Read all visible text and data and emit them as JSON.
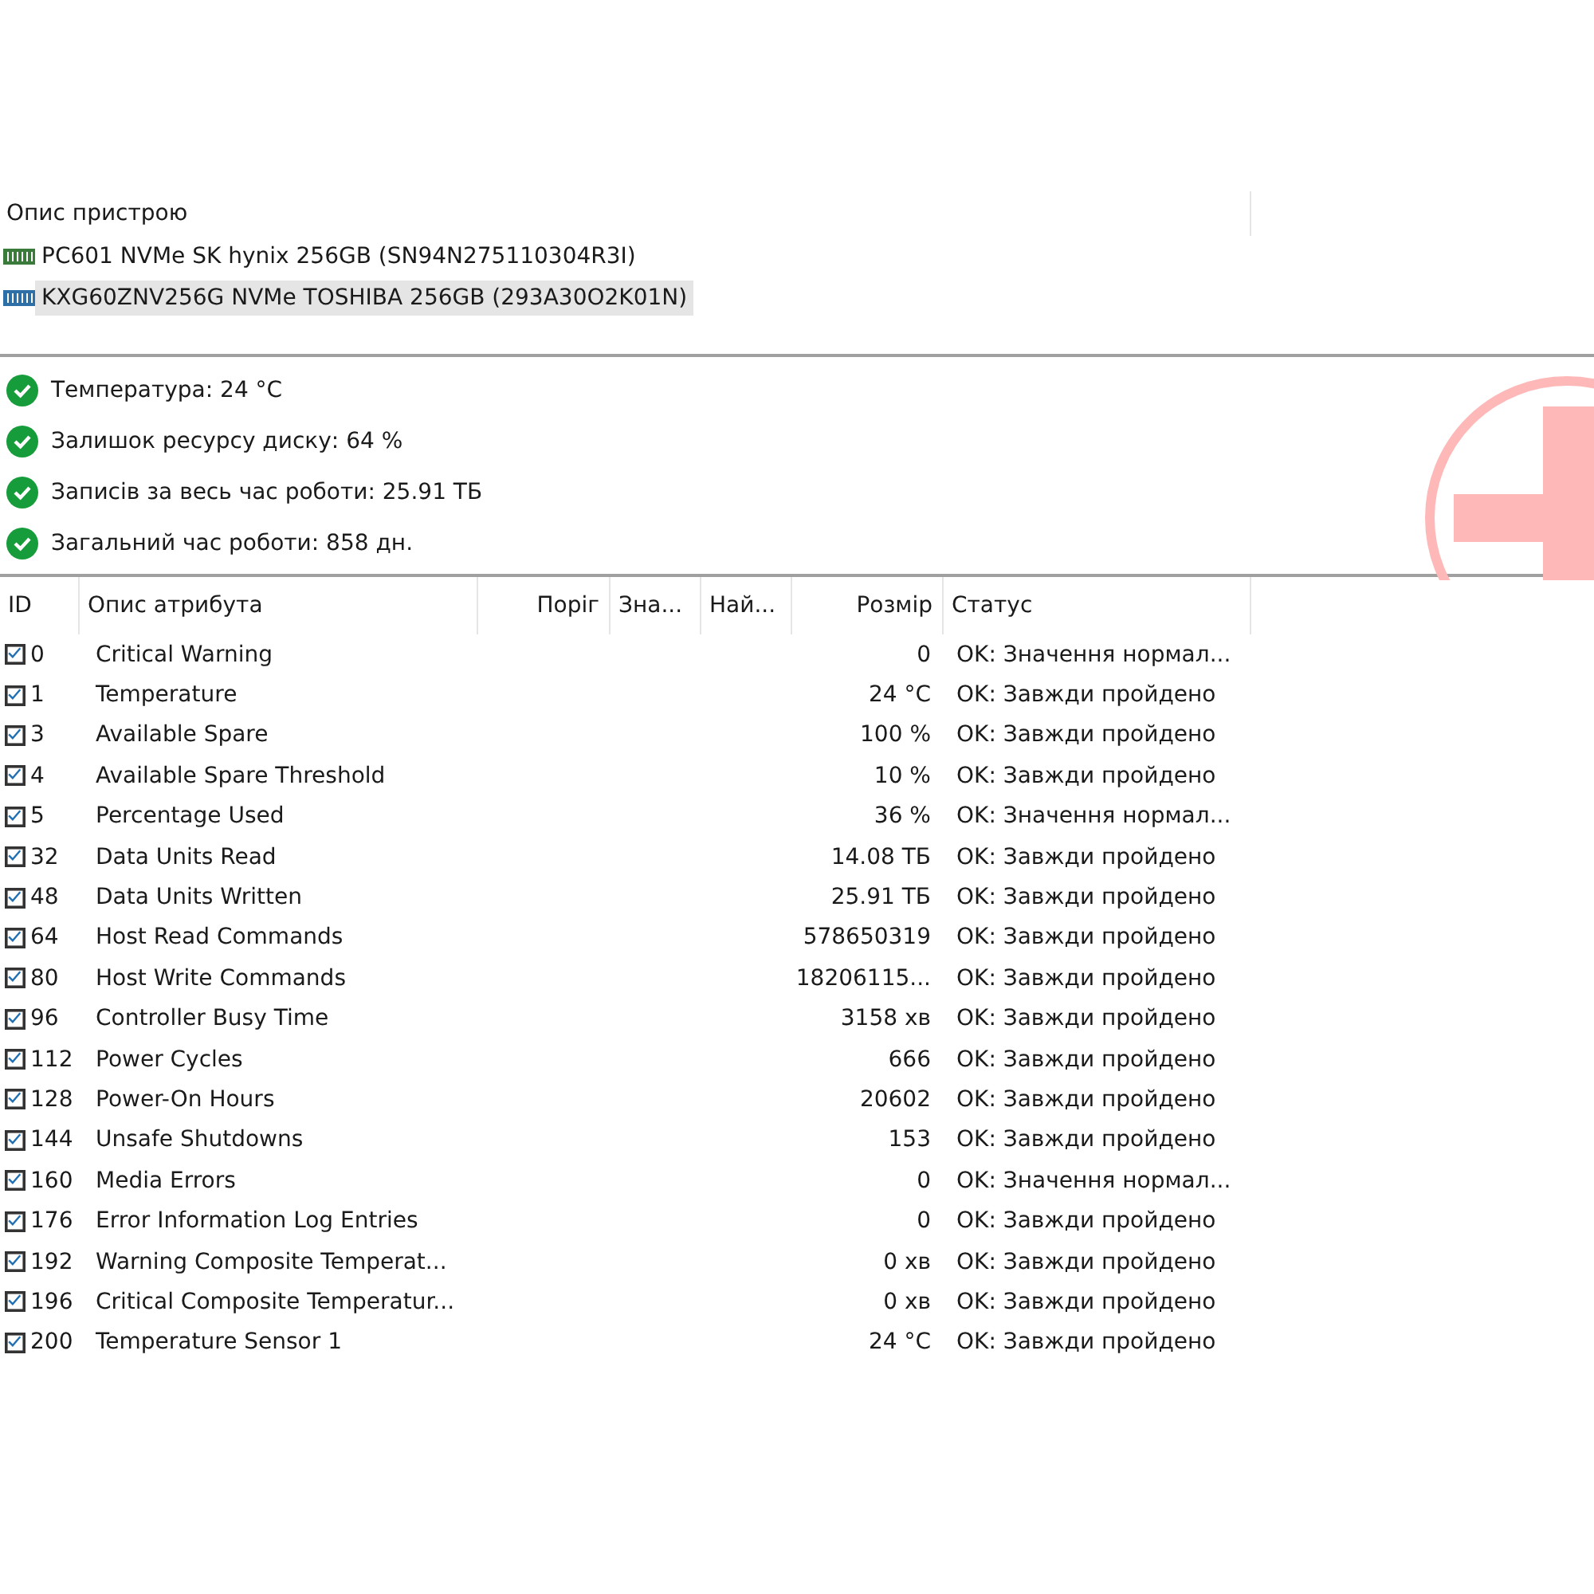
{
  "devices": {
    "header": "Опис пристрою",
    "items": [
      {
        "name": "PC601 NVMe SK hynix 256GB (SN94N275110304R3I)",
        "selected": false,
        "color": "#3a7a3a"
      },
      {
        "name": "KXG60ZNV256G NVMe TOSHIBA 256GB (293A30O2K01N)",
        "selected": true,
        "color": "#2f6fa8"
      }
    ]
  },
  "summary": [
    {
      "text": "Температура: 24 °C",
      "kind": "ok"
    },
    {
      "text": "Залишок ресурсу диску: 64 %",
      "kind": "ok"
    },
    {
      "text": "Записів за весь час роботи: 25.91 ТБ",
      "kind": "ok"
    },
    {
      "text": "Загальний час роботи: 858 дн.",
      "kind": "ok"
    }
  ],
  "table": {
    "columns": [
      "ID",
      "Опис атрибута",
      "Поріг",
      "Зна...",
      "Най...",
      "Розмір",
      "Статус"
    ],
    "rows": [
      {
        "checked": true,
        "id": "0",
        "name": "Critical Warning",
        "size": "0",
        "status": "OK: Значення нормал..."
      },
      {
        "checked": true,
        "id": "1",
        "name": "Temperature",
        "size": "24 °C",
        "status": "OK: Завжди пройдено"
      },
      {
        "checked": true,
        "id": "3",
        "name": "Available Spare",
        "size": "100 %",
        "status": "OK: Завжди пройдено"
      },
      {
        "checked": true,
        "id": "4",
        "name": "Available Spare Threshold",
        "size": "10 %",
        "status": "OK: Завжди пройдено"
      },
      {
        "checked": true,
        "id": "5",
        "name": "Percentage Used",
        "size": "36 %",
        "status": "OK: Значення нормал..."
      },
      {
        "checked": true,
        "id": "32",
        "name": "Data Units Read",
        "size": "14.08 ТБ",
        "status": "OK: Завжди пройдено"
      },
      {
        "checked": true,
        "id": "48",
        "name": "Data Units Written",
        "size": "25.91 ТБ",
        "status": "OK: Завжди пройдено"
      },
      {
        "checked": true,
        "id": "64",
        "name": "Host Read Commands",
        "size": "578650319",
        "status": "OK: Завжди пройдено"
      },
      {
        "checked": true,
        "id": "80",
        "name": "Host Write Commands",
        "size": "18206115...",
        "status": "OK: Завжди пройдено"
      },
      {
        "checked": true,
        "id": "96",
        "name": "Controller Busy Time",
        "size": "3158 хв",
        "status": "OK: Завжди пройдено"
      },
      {
        "checked": true,
        "id": "112",
        "name": "Power Cycles",
        "size": "666",
        "status": "OK: Завжди пройдено"
      },
      {
        "checked": true,
        "id": "128",
        "name": "Power-On Hours",
        "size": "20602",
        "status": "OK: Завжди пройдено"
      },
      {
        "checked": true,
        "id": "144",
        "name": "Unsafe Shutdowns",
        "size": "153",
        "status": "OK: Завжди пройдено"
      },
      {
        "checked": true,
        "id": "160",
        "name": "Media Errors",
        "size": "0",
        "status": "OK: Значення нормал..."
      },
      {
        "checked": true,
        "id": "176",
        "name": "Error Information Log Entries",
        "size": "0",
        "status": "OK: Завжди пройдено"
      },
      {
        "checked": true,
        "id": "192",
        "name": "Warning Composite Temperat...",
        "size": "0 хв",
        "status": "OK: Завжди пройдено"
      },
      {
        "checked": true,
        "id": "196",
        "name": "Critical Composite Temperatur...",
        "size": "0 хв",
        "status": "OK: Завжди пройдено"
      },
      {
        "checked": true,
        "id": "200",
        "name": "Temperature Sensor 1",
        "size": "24 °C",
        "status": "OK: Завжди пройдено"
      }
    ]
  }
}
